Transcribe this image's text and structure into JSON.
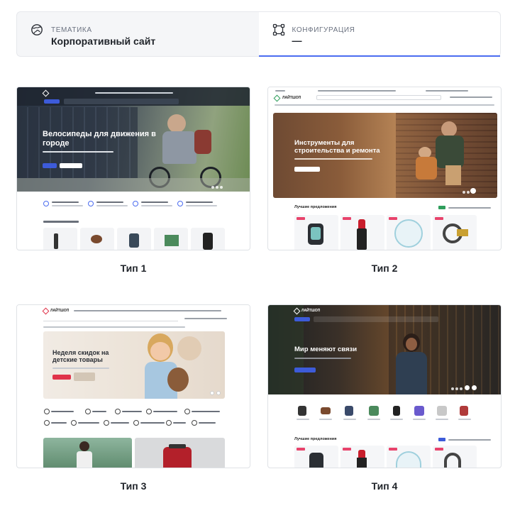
{
  "tabs": {
    "theme": {
      "caption": "ТЕМАТИКА",
      "value": "Корпоративный сайт",
      "icon": "globe-icon"
    },
    "config": {
      "caption": "КОНФИГУРАЦИЯ",
      "value": "—",
      "icon": "nodes-icon"
    }
  },
  "cards": [
    {
      "label": "Тип 1",
      "hero_title": "Велосипеды для движения в городе"
    },
    {
      "label": "Тип 2",
      "hero_title": "Инструменты для строительства и ремонта",
      "section": "Лучшие предложения"
    },
    {
      "label": "Тип 3",
      "hero_title": "Неделя скидок на детские товары"
    },
    {
      "label": "Тип 4",
      "hero_title": "Мир меняют связи",
      "section": "Лучшие предложения"
    }
  ],
  "colors": {
    "accent": "#4b6cf0",
    "brand": "#e0334a",
    "green": "#2f9e5c"
  }
}
